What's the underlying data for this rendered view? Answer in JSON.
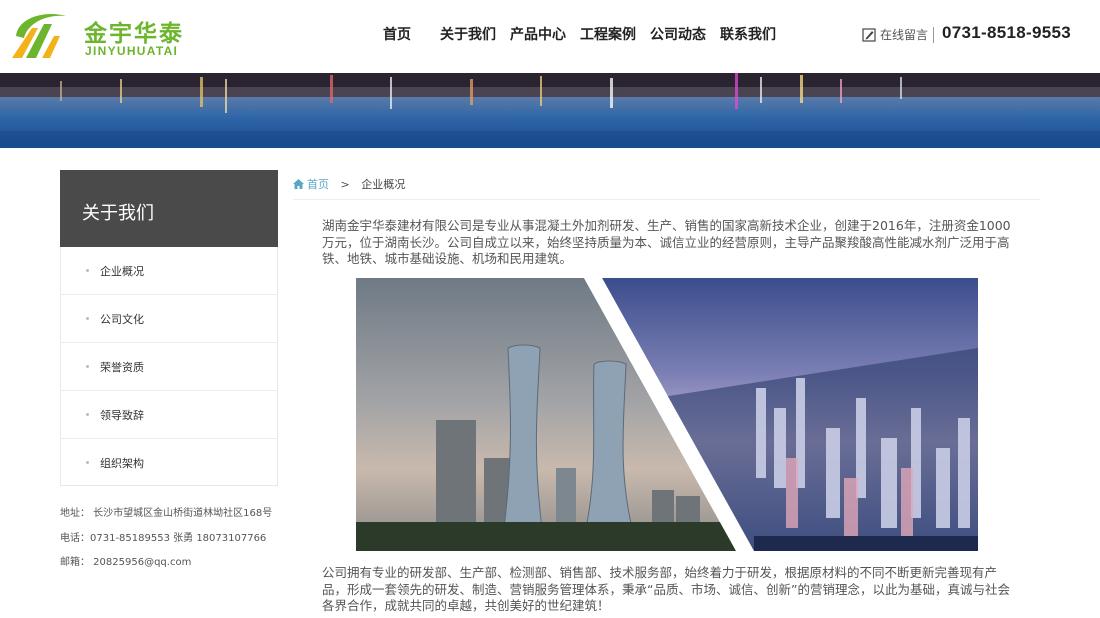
{
  "brand": {
    "name_cn": "金宇华泰",
    "name_en": "JINYUHUATAI"
  },
  "nav": {
    "items": [
      "首页",
      "关于我们",
      "产品中心",
      "工程案例",
      "公司动态",
      "联系我们"
    ]
  },
  "header": {
    "message_label": "在线留言",
    "phone": "0731-8518-9553"
  },
  "sidebar": {
    "title": "关于我们",
    "items": [
      "企业概况",
      "公司文化",
      "荣誉资质",
      "领导致辞",
      "组织架构"
    ]
  },
  "contact": {
    "address": "地址： 长沙市望城区金山桥街道林坳社区168号",
    "phone": "电话：0731-85189553 张勇 18073107766",
    "email": "邮箱： 20825956@qq.com"
  },
  "breadcrumb": {
    "home": "首页",
    "separator": ">",
    "current": "企业概况"
  },
  "content": {
    "para1": "湖南金宇华泰建材有限公司是专业从事混凝土外加剂研发、生产、销售的国家高新技术企业，创建于2016年，注册资金1000万元，位于湖南长沙。公司自成立以来，始终坚持质量为本、诚信立业的经营原则，主导产品聚羧酸高性能减水剂广泛用于高铁、地铁、城市基础设施、机场和民用建筑。",
    "para2": "公司拥有专业的研发部、生产部、检测部、销售部、技术服务部，始终着力于研发，根据原材料的不同不断更新完善现有产品，形成一套领先的研发、制造、营销服务管理体系，秉承“品质、市场、诚信、创新”的营销理念，以此为基础，真诚与社会各界合作，成就共同的卓越，共创美好的世纪建筑！"
  },
  "colors": {
    "brand_green": "#6cb52d",
    "sidebar_header": "#4a4a4a",
    "link_blue": "#5aa7c4"
  }
}
